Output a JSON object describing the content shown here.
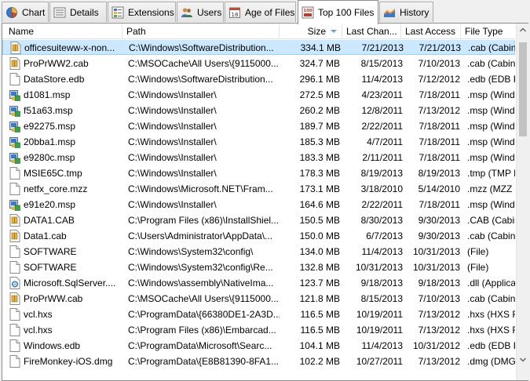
{
  "tabs": [
    {
      "label": "Chart",
      "icon": "pie-chart-icon"
    },
    {
      "label": "Details",
      "icon": "details-icon"
    },
    {
      "label": "Extensions",
      "icon": "extensions-icon"
    },
    {
      "label": "Users",
      "icon": "users-icon"
    },
    {
      "label": "Age of Files",
      "icon": "calendar-icon"
    },
    {
      "label": "Top 100 Files",
      "icon": "top100-icon"
    },
    {
      "label": "History",
      "icon": "history-chart-icon"
    }
  ],
  "active_tab": 5,
  "columns": {
    "name": "Name",
    "path": "Path",
    "size": "Size",
    "last_change": "Last Chan...",
    "last_access": "Last Access",
    "file_type": "File Type"
  },
  "sort": {
    "column": "size",
    "direction": "descending"
  },
  "rows": [
    {
      "name": "officesuiteww-x-non...",
      "path": "C:\\Windows\\SoftwareDistribution...",
      "size": "334.1 MB",
      "change": "7/21/2013",
      "access": "7/21/2013",
      "type": ".cab (Cabine",
      "icon": "cab"
    },
    {
      "name": "ProPrWW2.cab",
      "path": "C:\\MSOCache\\All Users\\{9115000...",
      "size": "324.7 MB",
      "change": "8/15/2013",
      "access": "7/10/2013",
      "type": ".cab (Cabine",
      "icon": "cab"
    },
    {
      "name": "DataStore.edb",
      "path": "C:\\Windows\\SoftwareDistribution...",
      "size": "296.1 MB",
      "change": "11/4/2013",
      "access": "7/12/2012",
      "type": ".edb (EDB Fi",
      "icon": "doc"
    },
    {
      "name": "d1081.msp",
      "path": "C:\\Windows\\Installer\\",
      "size": "272.5 MB",
      "change": "4/23/2011",
      "access": "7/18/2011",
      "type": ".msp (Wind",
      "icon": "msp"
    },
    {
      "name": "f51a63.msp",
      "path": "C:\\Windows\\Installer\\",
      "size": "260.2 MB",
      "change": "12/8/2011",
      "access": "7/13/2012",
      "type": ".msp (Wind",
      "icon": "msp"
    },
    {
      "name": "e92275.msp",
      "path": "C:\\Windows\\Installer\\",
      "size": "189.7 MB",
      "change": "2/22/2011",
      "access": "7/18/2011",
      "type": ".msp (Wind",
      "icon": "msp"
    },
    {
      "name": "20bba1.msp",
      "path": "C:\\Windows\\Installer\\",
      "size": "185.3 MB",
      "change": "4/7/2011",
      "access": "7/18/2011",
      "type": ".msp (Wind",
      "icon": "msp"
    },
    {
      "name": "e9280c.msp",
      "path": "C:\\Windows\\Installer\\",
      "size": "183.3 MB",
      "change": "2/11/2011",
      "access": "7/18/2011",
      "type": ".msp (Wind",
      "icon": "msp"
    },
    {
      "name": "MSIE65C.tmp",
      "path": "C:\\Windows\\Installer\\",
      "size": "178.3 MB",
      "change": "8/19/2013",
      "access": "8/19/2013",
      "type": ".tmp (TMP F",
      "icon": "doc"
    },
    {
      "name": "netfx_core.mzz",
      "path": "C:\\Windows\\Microsoft.NET\\Fram...",
      "size": "173.1 MB",
      "change": "3/18/2010",
      "access": "5/14/2010",
      "type": ".mzz (MZZ F",
      "icon": "doc"
    },
    {
      "name": "e91e20.msp",
      "path": "C:\\Windows\\Installer\\",
      "size": "164.6 MB",
      "change": "2/22/2011",
      "access": "7/18/2011",
      "type": ".msp (Wind",
      "icon": "msp"
    },
    {
      "name": "DATA1.CAB",
      "path": "C:\\Program Files (x86)\\InstallShiel...",
      "size": "150.5 MB",
      "change": "8/30/2013",
      "access": "9/30/2013",
      "type": ".CAB (Cabin",
      "icon": "cab"
    },
    {
      "name": "Data1.cab",
      "path": "C:\\Users\\Administrator\\AppData\\...",
      "size": "150.0 MB",
      "change": "6/7/2013",
      "access": "9/30/2013",
      "type": ".cab (Cabine",
      "icon": "cab"
    },
    {
      "name": "SOFTWARE",
      "path": "C:\\Windows\\System32\\config\\",
      "size": "134.0 MB",
      "change": "11/4/2013",
      "access": "10/31/2013",
      "type": "(File)",
      "icon": "doc"
    },
    {
      "name": "SOFTWARE",
      "path": "C:\\Windows\\System32\\config\\Re...",
      "size": "132.8 MB",
      "change": "10/31/2013",
      "access": "10/31/2013",
      "type": "(File)",
      "icon": "doc"
    },
    {
      "name": "Microsoft.SqlServer....",
      "path": "C:\\Windows\\assembly\\NativeIma...",
      "size": "123.7 MB",
      "change": "9/18/2013",
      "access": "9/18/2013",
      "type": ".dll (Applica",
      "icon": "dll"
    },
    {
      "name": "ProPrWW.cab",
      "path": "C:\\MSOCache\\All Users\\{9115000...",
      "size": "121.8 MB",
      "change": "8/15/2013",
      "access": "7/10/2013",
      "type": ".cab (Cabine",
      "icon": "cab"
    },
    {
      "name": "vcl.hxs",
      "path": "C:\\ProgramData\\{66380DE1-2A3D...",
      "size": "116.5 MB",
      "change": "10/19/2011",
      "access": "7/13/2012",
      "type": ".hxs (HXS Fi",
      "icon": "doc"
    },
    {
      "name": "vcl.hxs",
      "path": "C:\\Program Files (x86)\\Embarcad...",
      "size": "116.5 MB",
      "change": "10/19/2011",
      "access": "7/13/2012",
      "type": ".hxs (HXS Fi",
      "icon": "doc"
    },
    {
      "name": "Windows.edb",
      "path": "C:\\ProgramData\\Microsoft\\Searc...",
      "size": "104.1 MB",
      "change": "11/4/2013",
      "access": "10/31/2012",
      "type": ".edb (EDB Fi",
      "icon": "doc"
    },
    {
      "name": "FireMonkey-iOS.dmg",
      "path": "C:\\ProgramData\\{E8B81390-8FA1...",
      "size": "102.2 MB",
      "change": "10/27/2011",
      "access": "7/13/2012",
      "type": ".dmg (DMG",
      "icon": "doc"
    }
  ],
  "selected_row": 0,
  "colors": {
    "selection": "#cce8ff",
    "selection_border": "#99d1ff",
    "sort_arrow": "#6d9fd1"
  }
}
